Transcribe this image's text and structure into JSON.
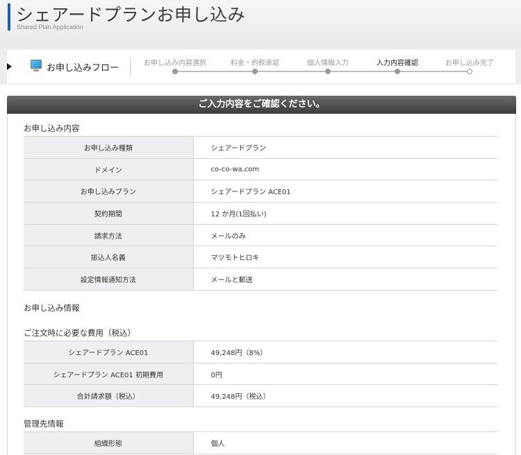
{
  "header": {
    "title": "シェアードプランお申し込み",
    "subtitle": "Shared Plan Application"
  },
  "flow": {
    "label": "お申し込みフロー",
    "steps": [
      {
        "label": "お申し込み内容選択",
        "state": "done"
      },
      {
        "label": "料金・約款承認",
        "state": "done"
      },
      {
        "label": "個人情報入力",
        "state": "done"
      },
      {
        "label": "入力内容確認",
        "state": "current"
      },
      {
        "label": "お申し込み完了",
        "state": "pending"
      }
    ]
  },
  "panel": {
    "header": "ご入力内容をご確認ください。"
  },
  "application_details": {
    "title": "お申し込み内容",
    "rows": [
      {
        "label": "お申し込み種類",
        "value": "シェアードプラン"
      },
      {
        "label": "ドメイン",
        "value": "co-co-wa.com"
      },
      {
        "label": "お申し込みプラン",
        "value": "シェアードプラン ACE01"
      },
      {
        "label": "契約期間",
        "value": "12 か月(1回払い)"
      },
      {
        "label": "請求方法",
        "value": "メールのみ"
      },
      {
        "label": "振込人名義",
        "value": "マツモトヒロキ"
      },
      {
        "label": "設定情報通知方法",
        "value": "メールと郵送"
      }
    ]
  },
  "application_info": {
    "title": "お申し込み情報"
  },
  "fees": {
    "title": "ご注文時に必要な費用（税込）",
    "rows": [
      {
        "label": "シェアードプラン ACE01",
        "value": "49,248円（8%）"
      },
      {
        "label": "シェアードプラン ACE01 初期費用",
        "value": "0円"
      },
      {
        "label": "合計請求額（税込）",
        "value": "49,248円（税込）"
      }
    ]
  },
  "management": {
    "title": "管理先情報",
    "rows": [
      {
        "label": "組織形態",
        "value": "個人"
      }
    ]
  }
}
